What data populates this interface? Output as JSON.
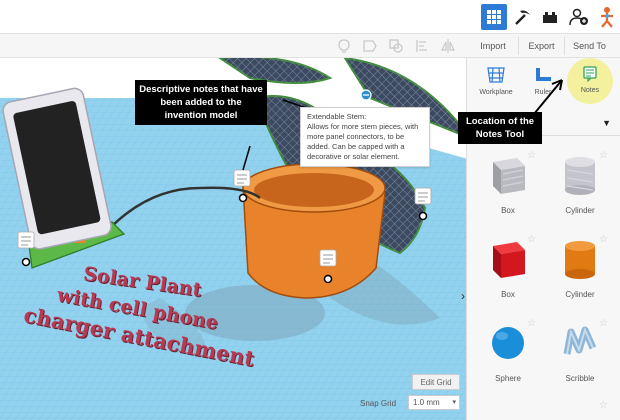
{
  "toolbar": {
    "import_label": "Import",
    "export_label": "Export",
    "send_to_label": "Send To"
  },
  "panel": {
    "tools": [
      {
        "label": "Workplane",
        "icon": "workplane-icon"
      },
      {
        "label": "Ruler",
        "icon": "ruler-icon"
      },
      {
        "label": "Notes",
        "icon": "notes-icon"
      }
    ],
    "shapes": [
      {
        "label": "Box",
        "color": "#b9b9c0",
        "kind": "box-striped"
      },
      {
        "label": "Cylinder",
        "color": "#c4c4cc",
        "kind": "cylinder-striped"
      },
      {
        "label": "Box",
        "color": "#d3171f",
        "kind": "box-solid"
      },
      {
        "label": "Cylinder",
        "color": "#e27a14",
        "kind": "cylinder-solid"
      },
      {
        "label": "Sphere",
        "color": "#1a8ed8",
        "kind": "sphere"
      },
      {
        "label": "Scribble",
        "color": "#8fb6d6",
        "kind": "scribble"
      }
    ]
  },
  "callouts": {
    "notes_explainer": "Descriptive notes that have been added to the invention model",
    "tool_location": "Location of the Notes Tool"
  },
  "tooltip": {
    "title": "Extendable Stem:",
    "body": "Allows for more stem pieces, with more panel connectors, to be added. Can be capped with a decorative or solar element."
  },
  "overlay_title": {
    "line1": "Solar Plant",
    "line2": "with cell phone",
    "line3": "charger attachment"
  },
  "grid_controls": {
    "edit_grid_label": "Edit Grid",
    "snap_grid_label": "Snap Grid",
    "snap_value": "1.0 mm"
  },
  "colors": {
    "accent_blue": "#2e7bd6",
    "workplane": "#8fd0ee",
    "pot": "#e9832b",
    "phone_base": "#5cb947",
    "notes_highlight": "#f3f19e",
    "title_overlay": "#b83a52"
  }
}
